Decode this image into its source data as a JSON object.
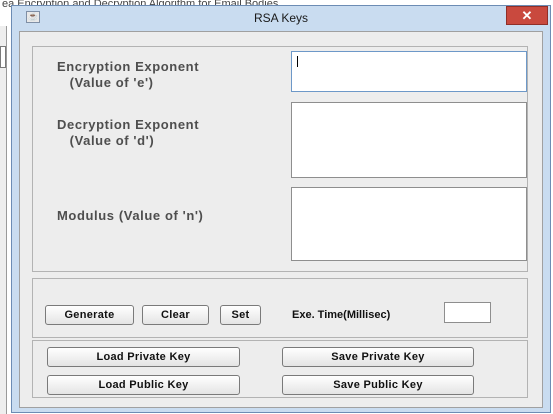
{
  "background_window": {
    "title_fragment": "ea Encryption and Decryption Algorithm for Email Bodies"
  },
  "window": {
    "title": "RSA Keys",
    "close_glyph": "✕",
    "icon_glyph": "☕"
  },
  "labels": {
    "encryption": "Encryption Exponent\n   (Value of 'e')",
    "decryption": "Decryption Exponent\n   (Value of 'd')",
    "modulus": "Modulus (Value of 'n')",
    "exe_time": "Exe. Time(Millisec)"
  },
  "fields": {
    "encryption_value": "",
    "decryption_value": "",
    "modulus_value": "",
    "exe_time_value": ""
  },
  "buttons": {
    "generate": "Generate",
    "clear": "Clear",
    "set": "Set",
    "load_private": "Load Private Key",
    "save_private": "Save Private Key",
    "load_public": "Load Public Key",
    "save_public": "Save Public Key"
  },
  "colors": {
    "titlebar": "#c9dcf0",
    "close": "#c9493e",
    "content_bg": "#ededed",
    "label_text": "#4e4e4e"
  }
}
